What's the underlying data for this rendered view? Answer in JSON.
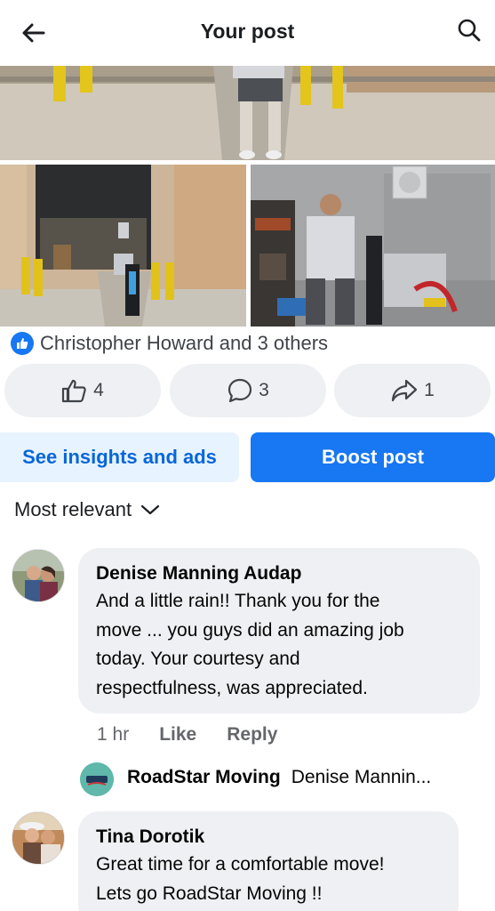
{
  "header": {
    "title": "Your post",
    "back_icon": "arrow-left-icon",
    "search_icon": "search-icon"
  },
  "reactions": {
    "names": "Christopher Howard and 3 others"
  },
  "actions": {
    "like_count": "4",
    "comment_count": "3",
    "share_count": "1"
  },
  "buttons": {
    "insights": "See insights and ads",
    "boost": "Boost post"
  },
  "sort": {
    "label": "Most relevant"
  },
  "comments": [
    {
      "author": "Denise Manning Audap",
      "text": "And a little rain!!  Thank you for the\nmove ... you guys did an amazing job\ntoday.  Your  courtesy and\nrespectfulness, was appreciated.",
      "time": "1 hr",
      "like": "Like",
      "reply": "Reply",
      "reply_preview": {
        "author": "RoadStar Moving",
        "text": "Denise Mannin..."
      }
    },
    {
      "author": "Tina Dorotik",
      "text": "Great time for a comfortable move!\nLets go RoadStar Moving  !!"
    }
  ],
  "colors": {
    "accent": "#1877f2",
    "insights_bg": "#e7f3ff",
    "pill_bg": "#eef0f3"
  }
}
